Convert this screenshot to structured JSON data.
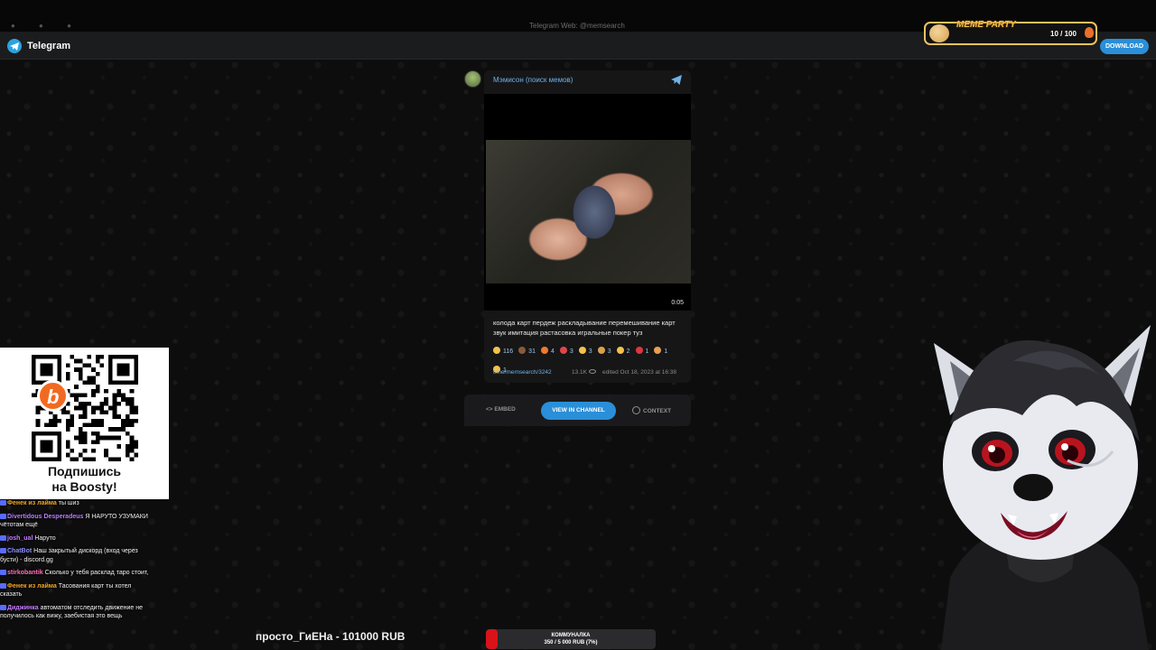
{
  "browser": {
    "url": "Telegram Web: @memsearch"
  },
  "telegram": {
    "brand": "Telegram",
    "download_label": "DOWNLOAD"
  },
  "meme_party": {
    "title": "MEME PARTY",
    "count": "10 / 100"
  },
  "post": {
    "channel_name": "Мэмисон (поиск мемов)",
    "duration": "0:05",
    "caption": "колода карт пердеж раскладывание перемешивание карт звук имитация растасовка игральные покер туз",
    "reactions": [
      {
        "count": "116",
        "color": "#f2c14e"
      },
      {
        "count": "31",
        "color": "#8a5a3c"
      },
      {
        "count": "4",
        "color": "#f07a2a"
      },
      {
        "count": "3",
        "color": "#e0454a"
      },
      {
        "count": "3",
        "color": "#f2c14e"
      },
      {
        "count": "3",
        "color": "#d8a24a"
      },
      {
        "count": "2",
        "color": "#f2c14e"
      },
      {
        "count": "1",
        "color": "#e0343c"
      },
      {
        "count": "1",
        "color": "#e8a050"
      },
      {
        "count": "1",
        "color": "#f2c14e"
      }
    ],
    "link": "t.me/memsearch/3242",
    "views": "13.1K",
    "edited": "edited Oct 18, 2023 at 16:38"
  },
  "actions": {
    "embed": "EMBED",
    "view_in_channel": "VIEW IN CHANNEL",
    "context": "CONTEXT"
  },
  "qr": {
    "line1": "Подпишись",
    "line2": "на Boosty!"
  },
  "chat": [
    {
      "user": "Фенек из лайма",
      "user_color": "#f5a623",
      "message": "ты шиз"
    },
    {
      "user": "Divertidous Desperadeus",
      "user_color": "#b77cff",
      "message": "Я НАРУТО УЗУМАКИ чётотам ещё"
    },
    {
      "user": "josh_ual",
      "user_color": "#c77dff",
      "message": "Наруто"
    },
    {
      "user": "ChatBot",
      "user_color": "#8f8fff",
      "message": "Наш закрытый дискорд (вход через бусти) - discord.gg"
    },
    {
      "user": "stirkobantik",
      "user_color": "#ff6fb5",
      "message": "Сколько у тебя расклад таро стоит,"
    },
    {
      "user": "Фенек из лайма",
      "user_color": "#f5a623",
      "message": "Тасования карт ты хотел сказать"
    },
    {
      "user": "Диджинка",
      "user_color": "#c77dff",
      "message": "автоматом отследить движение не получилось как вижу, заебистая это вещь"
    }
  ],
  "donation": {
    "donor_line": "просто_ГиЕНа - 101000 RUB"
  },
  "goal": {
    "title": "КОММУНАЛКА",
    "amount": "350 / 5 000 RUB (7%)",
    "progress": 0.07,
    "color": "#d8131a"
  }
}
